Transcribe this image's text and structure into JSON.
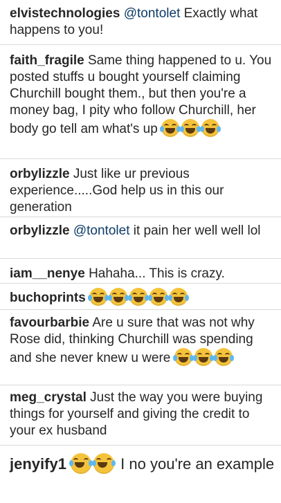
{
  "comments": [
    {
      "user": "elvistechnologies",
      "mention": "@tontolet",
      "text": " Exactly what happens to you!"
    },
    {
      "user": "faith_fragile",
      "text": " Same thing happened to u. You posted stuffs u bought yourself claiming Churchill bought them., but then you're a money bag, I pity who follow Churchill, her body go tell am what's up"
    },
    {
      "user": "orbylizzle",
      "text": " Just like ur previous experience.....God help us in this our generation"
    },
    {
      "user": "orbylizzle",
      "mention": "@tontolet",
      "text": " it pain her well well lol"
    },
    {
      "user": "iam__nenye",
      "text": " Hahaha... This is crazy."
    },
    {
      "user": "buchoprints",
      "text": " "
    },
    {
      "user": "favourbarbie",
      "text": " Are u sure that was not why Rose did, thinking Churchill was spending and she never knew u were"
    },
    {
      "user": "meg_crystal",
      "text": " Just the way you were buying things for yourself and giving the credit to your ex husband"
    },
    {
      "user": "jenyify1",
      "text": " I no you're an example"
    }
  ],
  "emoji_icon": "face-with-tears-of-joy",
  "colors": {
    "username": "#262626",
    "mention": "#0d3b66",
    "divider": "#d8d8d8",
    "emoji": "#f5c33b"
  }
}
